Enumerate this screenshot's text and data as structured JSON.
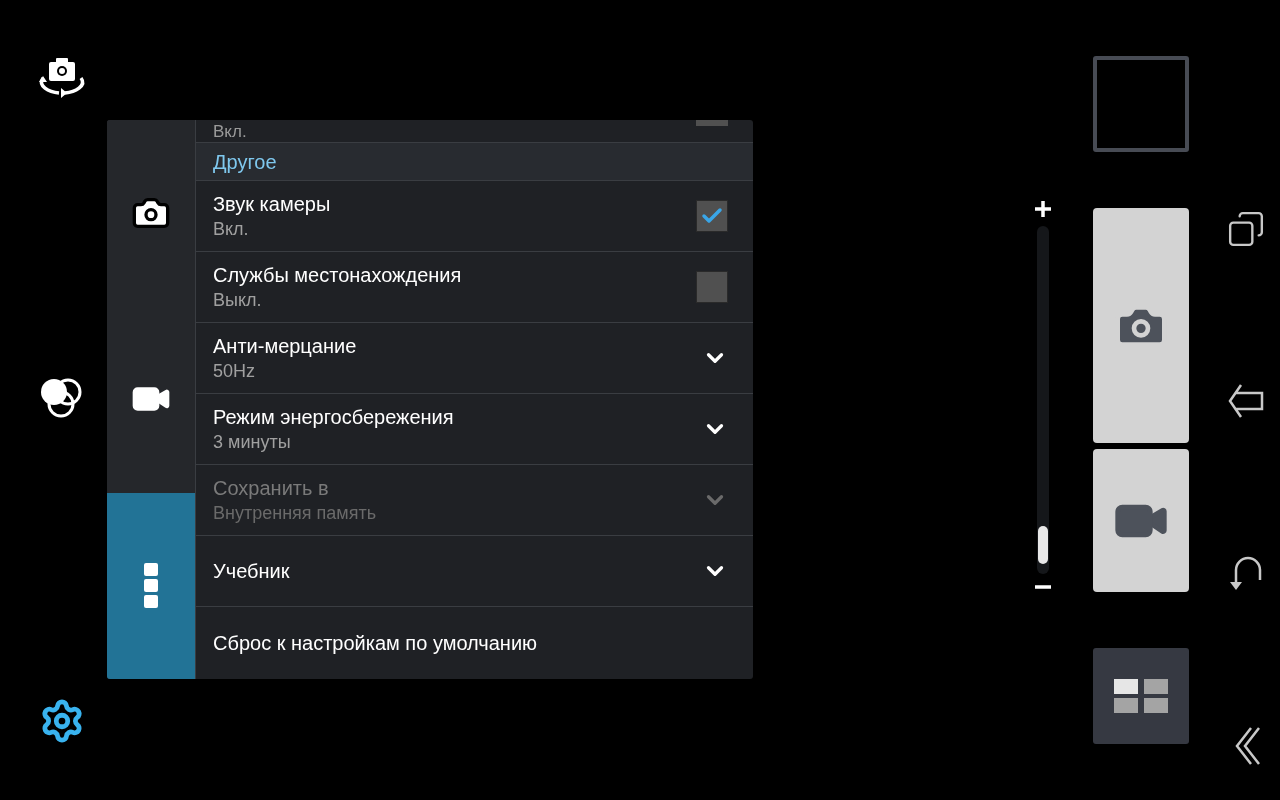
{
  "side_tabs": [
    {
      "kind": "camera",
      "selected": false
    },
    {
      "kind": "video",
      "selected": false
    },
    {
      "kind": "more",
      "selected": true
    }
  ],
  "settings": [
    {
      "kind": "partial",
      "subtitle": "Вкл.",
      "checked": false
    },
    {
      "kind": "header",
      "title": "Другое"
    },
    {
      "kind": "check",
      "title": "Звук камеры",
      "subtitle": "Вкл.",
      "checked": true
    },
    {
      "kind": "check",
      "title": "Службы местонахождения",
      "subtitle": "Выкл.",
      "checked": false
    },
    {
      "kind": "list",
      "title": "Анти-мерцание",
      "subtitle": "50Hz",
      "disabled": false
    },
    {
      "kind": "list",
      "title": "Режим энергосбережения",
      "subtitle": "3 минуты",
      "disabled": false
    },
    {
      "kind": "list",
      "title": "Сохранить в",
      "subtitle": "Внутренняя память",
      "disabled": true
    },
    {
      "kind": "list",
      "title": "Учебник",
      "disabled": false
    },
    {
      "kind": "action",
      "title": "Сброс к настройкам по умолчанию"
    }
  ],
  "zoom": {
    "level": 0.02
  }
}
